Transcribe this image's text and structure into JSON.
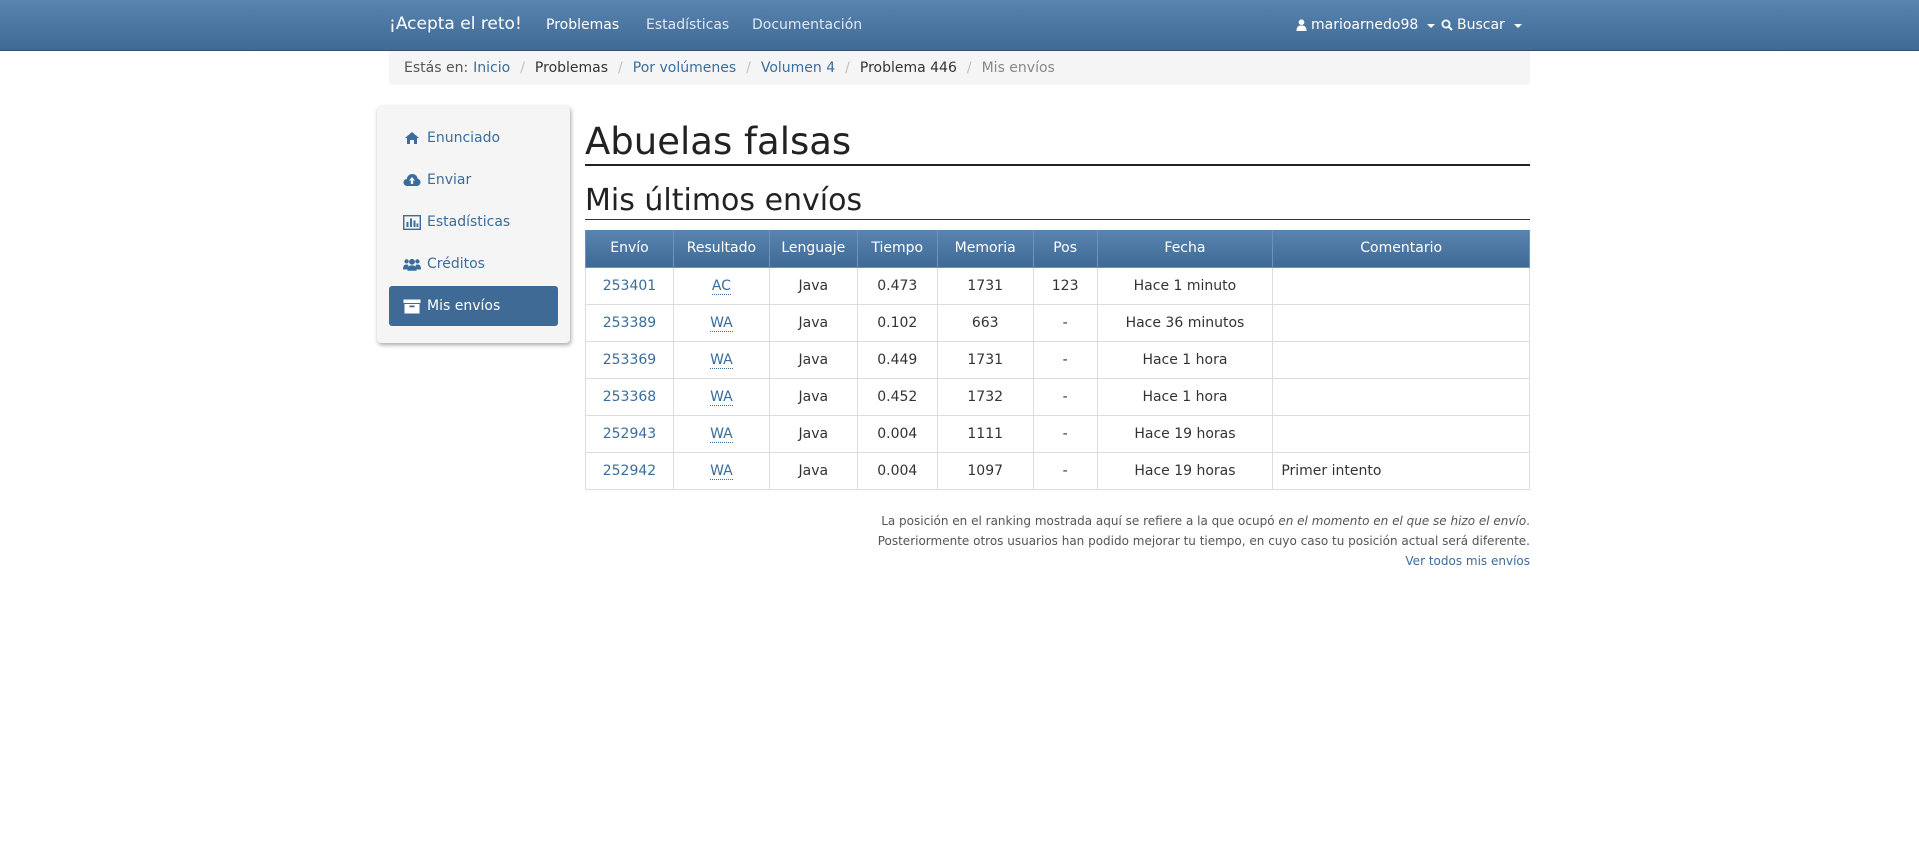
{
  "navbar": {
    "brand": "¡Acepta el reto!",
    "links": [
      "Problemas",
      "Estadísticas",
      "Documentación"
    ],
    "user": "marioarnedo98",
    "search": "Buscar"
  },
  "breadcrumb": {
    "prefix": "Estás en:",
    "items": [
      "Inicio",
      "Problemas",
      "Por volúmenes",
      "Volumen 4",
      "Problema 446",
      "Mis envíos"
    ]
  },
  "sidebar": {
    "items": [
      {
        "label": "Enunciado",
        "icon": "home-icon"
      },
      {
        "label": "Enviar",
        "icon": "cloud-upload-icon"
      },
      {
        "label": "Estadísticas",
        "icon": "bar-chart-icon"
      },
      {
        "label": "Créditos",
        "icon": "users-icon"
      },
      {
        "label": "Mis envíos",
        "icon": "archive-icon"
      }
    ]
  },
  "main": {
    "title": "Abuelas falsas",
    "subtitle": "Mis últimos envíos",
    "columns": [
      "Envío",
      "Resultado",
      "Lenguaje",
      "Tiempo",
      "Memoria",
      "Pos",
      "Fecha",
      "Comentario"
    ],
    "rows": [
      {
        "id": "253401",
        "result": "AC",
        "lang": "Java",
        "time": "0.473",
        "mem": "1731",
        "pos": "123",
        "date": "Hace 1 minuto",
        "comment": ""
      },
      {
        "id": "253389",
        "result": "WA",
        "lang": "Java",
        "time": "0.102",
        "mem": "663",
        "pos": "-",
        "date": "Hace 36 minutos",
        "comment": ""
      },
      {
        "id": "253369",
        "result": "WA",
        "lang": "Java",
        "time": "0.449",
        "mem": "1731",
        "pos": "-",
        "date": "Hace 1 hora",
        "comment": ""
      },
      {
        "id": "253368",
        "result": "WA",
        "lang": "Java",
        "time": "0.452",
        "mem": "1732",
        "pos": "-",
        "date": "Hace 1 hora",
        "comment": ""
      },
      {
        "id": "252943",
        "result": "WA",
        "lang": "Java",
        "time": "0.004",
        "mem": "1111",
        "pos": "-",
        "date": "Hace 19 horas",
        "comment": ""
      },
      {
        "id": "252942",
        "result": "WA",
        "lang": "Java",
        "time": "0.004",
        "mem": "1097",
        "pos": "-",
        "date": "Hace 19 horas",
        "comment": "Primer intento"
      }
    ],
    "note_line1_start": "La posición en el ranking mostrada aquí se refiere a la que ocupó ",
    "note_line1_em": "en el momento en el que se hizo el envío",
    "note_line1_end": ".",
    "note_line2": "Posteriormente otros usuarios han podido mejorar tu tiempo, en cuyo caso tu posición actual será diferente.",
    "view_all": "Ver todos mis envíos"
  },
  "colors": {
    "navbar": "#3f6a96",
    "link": "#3a6d9c",
    "active": "#3f6a96"
  }
}
